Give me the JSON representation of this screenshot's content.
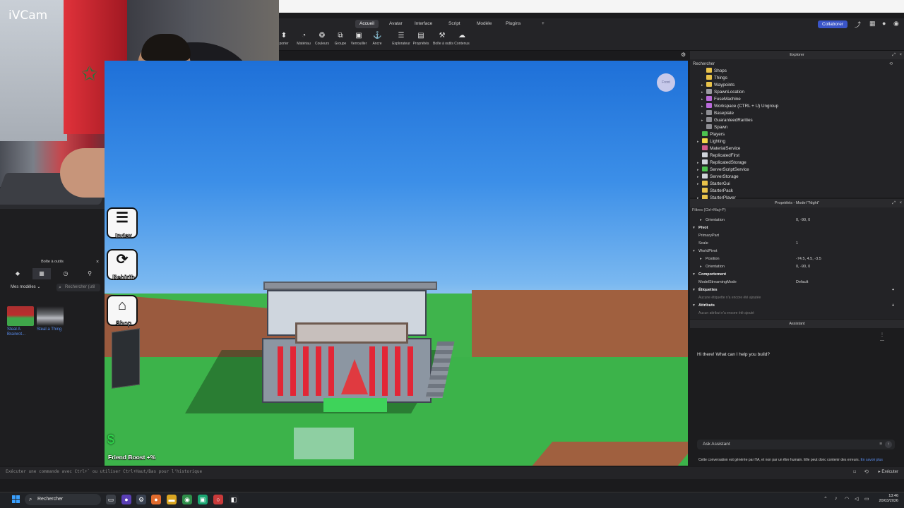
{
  "webcam": {
    "label": "iVCam"
  },
  "menu": {
    "tabs": [
      "Accueil",
      "Avatar",
      "Interface",
      "Script",
      "Modèle",
      "Plugins"
    ],
    "add_tab": "+",
    "collaborate": "Collaborer"
  },
  "toolbar": {
    "tools": [
      {
        "label": "porter",
        "icon": "import-icon"
      },
      {
        "label": "Matériau",
        "icon": "material-icon"
      },
      {
        "label": "Couleurs",
        "icon": "color-icon"
      },
      {
        "label": "Groupe",
        "icon": "group-icon"
      },
      {
        "label": "Verrouiller",
        "icon": "lock-icon"
      },
      {
        "label": "Ancre",
        "icon": "anchor-icon"
      },
      {
        "label": "Explorateur",
        "icon": "explorer-icon"
      },
      {
        "label": "Propriétés",
        "icon": "properties-icon"
      },
      {
        "label": "Boîte à outils",
        "icon": "toolbox-icon"
      },
      {
        "label": "Contenus",
        "icon": "assets-icon"
      }
    ]
  },
  "toolbox": {
    "title": "Boîte à outils",
    "dropdown": "Mes modèles",
    "search_placeholder": "Rechercher (util",
    "models": [
      {
        "label": "Steal A Brainrot..."
      },
      {
        "label": "Steal a Thing"
      }
    ]
  },
  "game": {
    "buttons": [
      {
        "label": "Index",
        "icon": "index-icon"
      },
      {
        "label": "Rebirth",
        "icon": "rebirth-icon"
      },
      {
        "label": "Shop",
        "icon": "shop-icon"
      }
    ],
    "friend_boost": "Friend Boost +%",
    "currency_symbol": "$",
    "viewcube_label": "Front"
  },
  "explorer": {
    "title": "Explorer",
    "search_label": "Rechercher",
    "items": [
      {
        "label": "Shops",
        "indent": 2,
        "arrow": "",
        "icon_color": "#e8c24a"
      },
      {
        "label": "Things",
        "indent": 2,
        "arrow": "",
        "icon_color": "#e8c24a"
      },
      {
        "label": "Waypoints",
        "indent": 2,
        "arrow": "▸",
        "icon_color": "#e8c24a"
      },
      {
        "label": "SpawnLocation",
        "indent": 2,
        "arrow": "▸",
        "icon_color": "#9a9aa0"
      },
      {
        "label": "FuseMachine",
        "indent": 2,
        "arrow": "▸",
        "icon_color": "#b96ad9"
      },
      {
        "label": "Workspace (CTRL + U) Ungroup",
        "indent": 2,
        "arrow": "▸",
        "icon_color": "#b96ad9"
      },
      {
        "label": "Baseplate",
        "indent": 2,
        "arrow": "▸",
        "icon_color": "#8c8c92"
      },
      {
        "label": "GuaranteedRarities",
        "indent": 2,
        "arrow": "▸",
        "icon_color": "#8c8c92"
      },
      {
        "label": "Spawn",
        "indent": 2,
        "arrow": "",
        "icon_color": "#8c8c92"
      },
      {
        "label": "Players",
        "indent": 1,
        "arrow": "",
        "icon_color": "#4cc24f"
      },
      {
        "label": "Lighting",
        "indent": 1,
        "arrow": "▸",
        "icon_color": "#f2d648"
      },
      {
        "label": "MaterialService",
        "indent": 1,
        "arrow": "",
        "icon_color": "#d25a8a"
      },
      {
        "label": "ReplicatedFirst",
        "indent": 1,
        "arrow": "",
        "icon_color": "#cfd3da"
      },
      {
        "label": "ReplicatedStorage",
        "indent": 1,
        "arrow": "▸",
        "icon_color": "#cfd3da"
      },
      {
        "label": "ServerScriptService",
        "indent": 1,
        "arrow": "▸",
        "icon_color": "#4cc24f"
      },
      {
        "label": "ServerStorage",
        "indent": 1,
        "arrow": "▸",
        "icon_color": "#cfd3da"
      },
      {
        "label": "StarterGui",
        "indent": 1,
        "arrow": "▸",
        "icon_color": "#e8c24a"
      },
      {
        "label": "StarterPack",
        "indent": 1,
        "arrow": "",
        "icon_color": "#e8c24a"
      },
      {
        "label": "StarterPlayer",
        "indent": 1,
        "arrow": "▸",
        "icon_color": "#e8c24a"
      }
    ]
  },
  "properties": {
    "title": "Propriétés - Model \"Night\"",
    "filter": "Filtres (Ctrl+Maj+P)",
    "rows": [
      {
        "name": "Orientation",
        "value": "0, -90, 0",
        "level": 1,
        "arrow": "▸",
        "section": false
      },
      {
        "name": "Pivot",
        "value": "",
        "level": 0,
        "arrow": "▾",
        "section": true
      },
      {
        "name": "PrimaryPart",
        "value": "",
        "level": 0,
        "arrow": "",
        "section": false
      },
      {
        "name": "Scale",
        "value": "1",
        "level": 0,
        "arrow": "",
        "section": false
      },
      {
        "name": "WorldPivot",
        "value": "",
        "level": 0,
        "arrow": "▾",
        "section": false
      },
      {
        "name": "Position",
        "value": "-74.5, 4.5, -3.5",
        "level": 1,
        "arrow": "▸",
        "section": false
      },
      {
        "name": "Orientation",
        "value": "0, -90, 0",
        "level": 1,
        "arrow": "▸",
        "section": false
      },
      {
        "name": "Comportement",
        "value": "",
        "level": 0,
        "arrow": "▾",
        "section": true
      },
      {
        "name": "ModelStreamingMode",
        "value": "Default",
        "level": 0,
        "arrow": "",
        "section": false
      },
      {
        "name": "Étiquettes",
        "value": "",
        "level": 0,
        "arrow": "▾",
        "section": true
      },
      {
        "name": "Aucune étiquette n'a encore été ajoutée",
        "value": "",
        "level": 0,
        "arrow": "",
        "section": false,
        "empty": true
      },
      {
        "name": "Attributs",
        "value": "",
        "level": 0,
        "arrow": "▾",
        "section": true
      },
      {
        "name": "Aucun attribut n'a encore été ajouté",
        "value": "",
        "level": 0,
        "arrow": "",
        "section": false,
        "empty": true
      }
    ]
  },
  "assistant": {
    "title": "Assistant",
    "greeting": "Hi there! What can I help you build?",
    "input_placeholder": "Ask Assistant",
    "disclaimer": "Cette conversation est générée par l'IA, et non par un être humain. Elle peut donc contenir des erreurs.",
    "link": "En savoir plus"
  },
  "command_bar": {
    "placeholder": "Exécuter une commande avec Ctrl+` ou utiliser Ctrl+Haut/Bas pour l'historique",
    "execute": "Exécuter"
  },
  "taskbar": {
    "search": "Rechercher",
    "time": "13:46",
    "date": "20/03/2026"
  }
}
